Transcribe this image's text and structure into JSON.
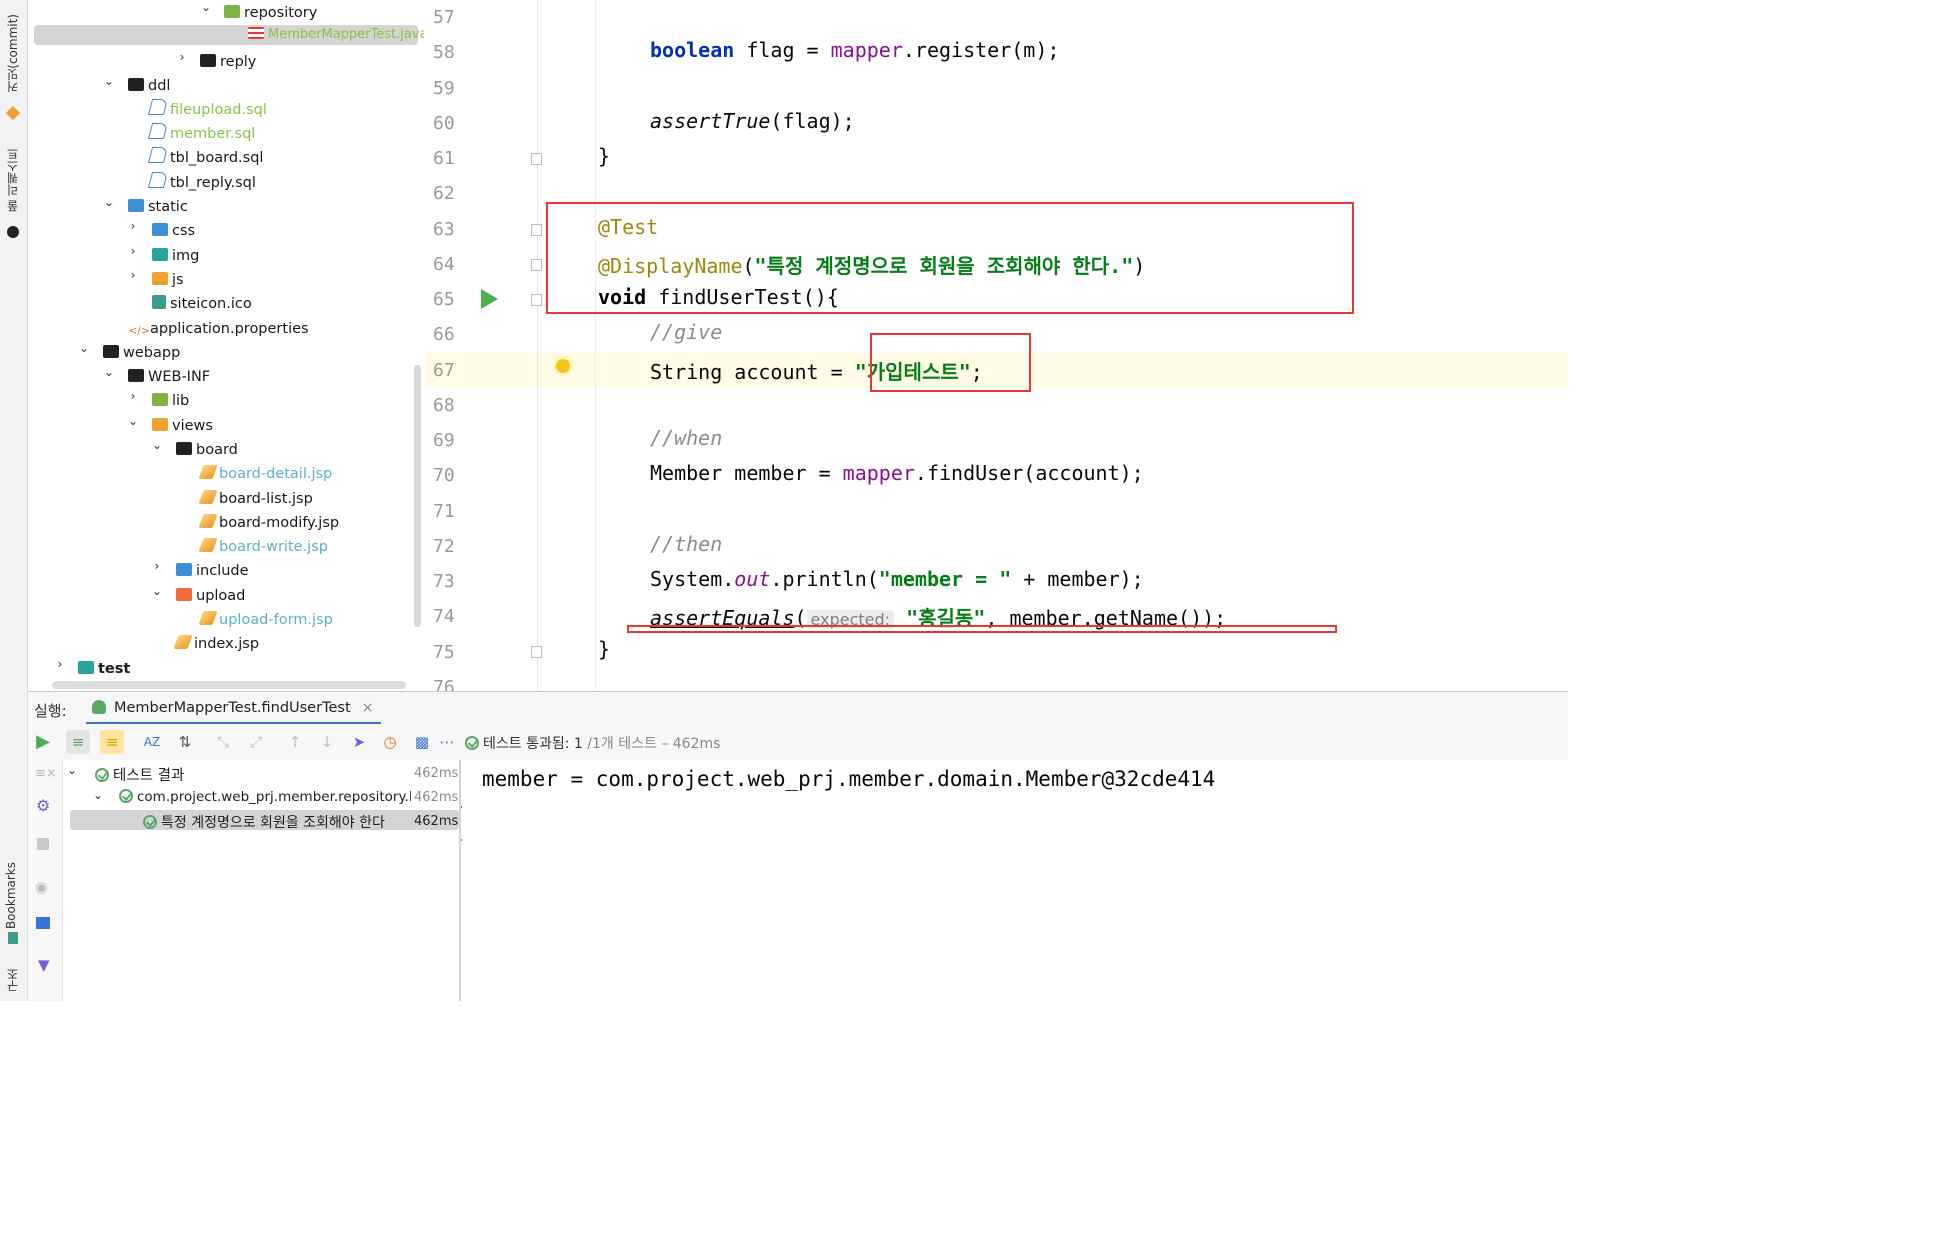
{
  "left_strip": {
    "commit_tab": "커밋(commit)",
    "pull_requests_tab": "풀 리퀘스트",
    "bookmarks_tab": "Bookmarks",
    "structure_tab": "구조"
  },
  "tree": {
    "repository": "repository",
    "selected_file": "MemberMapperTest.java",
    "reply": "reply",
    "ddl": "ddl",
    "fileupload_sql": "fileupload.sql",
    "member_sql": "member.sql",
    "tbl_board_sql": "tbl_board.sql",
    "tbl_reply_sql": "tbl_reply.sql",
    "static": "static",
    "css": "css",
    "img": "img",
    "js": "js",
    "siteicon": "siteicon.ico",
    "app_props": "application.properties",
    "webapp": "webapp",
    "webinf": "WEB-INF",
    "lib": "lib",
    "views": "views",
    "board": "board",
    "board_detail": "board-detail.jsp",
    "board_list": "board-list.jsp",
    "board_modify": "board-modify.jsp",
    "board_write": "board-write.jsp",
    "include": "include",
    "upload": "upload",
    "upload_form": "upload-form.jsp",
    "index_jsp": "index.jsp",
    "test": "test"
  },
  "editor": {
    "line_numbers": [
      "57",
      "58",
      "59",
      "60",
      "61",
      "62",
      "63",
      "64",
      "65",
      "66",
      "67",
      "68",
      "69",
      "70",
      "71",
      "72",
      "73",
      "74",
      "75",
      "76"
    ],
    "l58": {
      "kw": "boolean",
      "a": " flag = ",
      "fld": "mapper",
      "b": ".register(m);"
    },
    "l60": {
      "it": "assertTrue",
      "b": "(flag);"
    },
    "l61": "}",
    "l63": "@Test",
    "l64": {
      "ann": "@DisplayName",
      "a": "(",
      "str": "\"특정 계정명으로 회원을 조회해야 한다.\"",
      "b": ")"
    },
    "l65": {
      "kw": "void",
      "b": " findUserTest(){"
    },
    "l66": "//give",
    "l67": {
      "a": "String account = ",
      "str": "\"가입테스트\"",
      "b": ";"
    },
    "l69": "//when",
    "l70": {
      "a": "Member member = ",
      "fld": "mapper",
      "b": ".findUser(account);"
    },
    "l72": "//then",
    "l73": {
      "a": "System.",
      "fld": "out",
      "b": ".println(",
      "str": "\"member = \"",
      "c": " + member);"
    },
    "l74": {
      "it": "assertEquals",
      "a": "(",
      "hint": "expected:",
      "str": "\"홍길동\"",
      "b": ", member.getName());"
    },
    "l75": "}"
  },
  "run": {
    "label": "실행:",
    "tab": "MemberMapperTest.findUserTest",
    "status_pass": "테스트 통과됨: 1",
    "status_of": "/1개 테스트",
    "status_time": "– 462ms",
    "tree_root": "테스트 결과",
    "tree_root_time": "462ms",
    "tree_class": "com.project.web_prj.member.repository.M",
    "tree_class_time": "462ms",
    "tree_method": "특정 계정명으로 회원을 조회해야 한다",
    "tree_method_time": "462ms",
    "console_output": "member = com.project.web_prj.member.domain.Member@32cde414"
  }
}
